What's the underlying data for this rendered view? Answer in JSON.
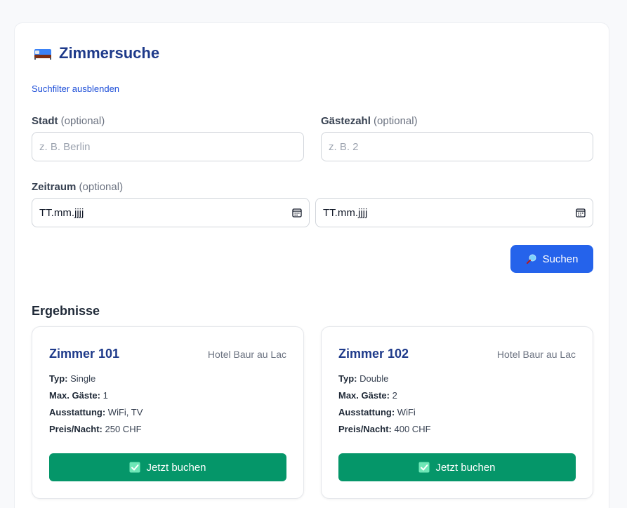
{
  "header": {
    "title": "Zimmersuche",
    "toggle_filters": "Suchfilter ausblenden"
  },
  "form": {
    "city": {
      "label": "Stadt",
      "optional": "(optional)",
      "placeholder": "z. B. Berlin",
      "value": ""
    },
    "guests": {
      "label": "Gästezahl",
      "optional": "(optional)",
      "placeholder": "z. B. 2",
      "value": ""
    },
    "period": {
      "label": "Zeitraum",
      "optional": "(optional)",
      "from": "TT.mm.jjjj",
      "to": "TT.mm.jjjj"
    },
    "search_label": "Suchen"
  },
  "results": {
    "heading": "Ergebnisse",
    "rooms": [
      {
        "name": "Zimmer 101",
        "hotel": "Hotel Baur au Lac",
        "type_label": "Typ:",
        "type": "Single",
        "guests_label": "Max. Gäste:",
        "guests": "1",
        "amenities_label": "Ausstattung:",
        "amenities": "WiFi, TV",
        "price_label": "Preis/Nacht:",
        "price": "250 CHF",
        "book_label": "Jetzt buchen"
      },
      {
        "name": "Zimmer 102",
        "hotel": "Hotel Baur au Lac",
        "type_label": "Typ:",
        "type": "Double",
        "guests_label": "Max. Gäste:",
        "guests": "2",
        "amenities_label": "Ausstattung:",
        "amenities": "WiFi",
        "price_label": "Preis/Nacht:",
        "price": "400 CHF",
        "book_label": "Jetzt buchen"
      }
    ]
  },
  "colors": {
    "primary": "#2563eb",
    "success": "#059669",
    "heading": "#1e3a8a"
  }
}
